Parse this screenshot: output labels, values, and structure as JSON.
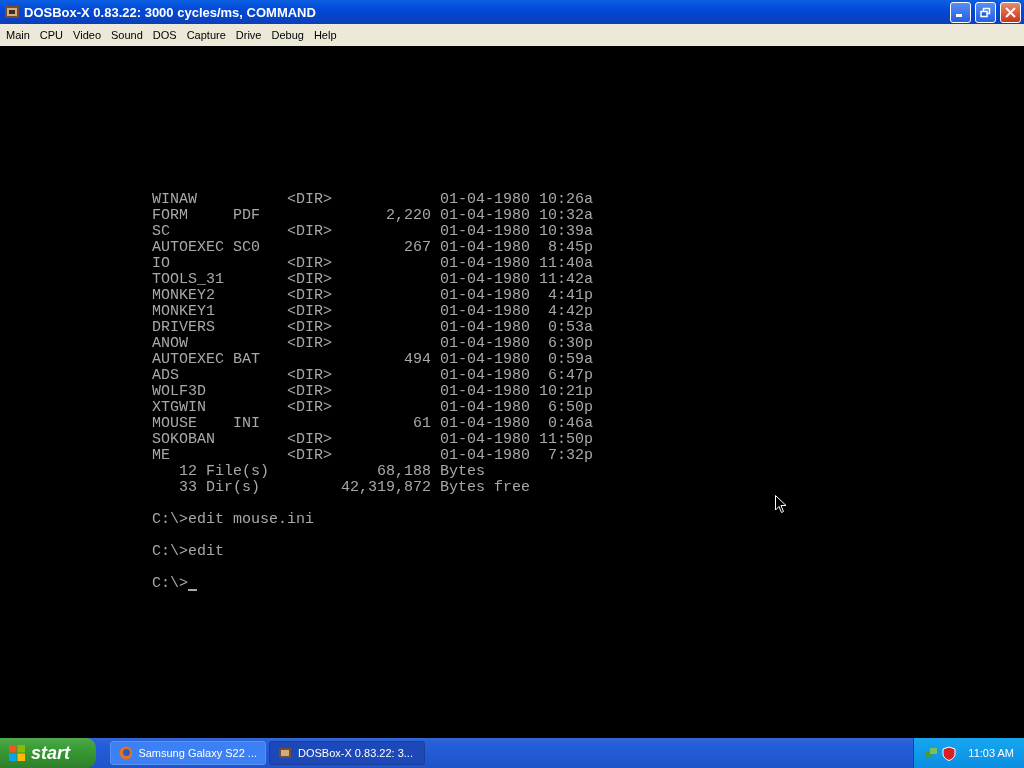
{
  "window": {
    "title": "DOSBox-X 0.83.22: 3000 cycles/ms, COMMAND",
    "buttons": [
      {
        "kind": "minimize"
      },
      {
        "kind": "restore"
      },
      {
        "kind": "close"
      }
    ]
  },
  "menu": [
    "Main",
    "CPU",
    "Video",
    "Sound",
    "DOS",
    "Capture",
    "Drive",
    "Debug",
    "Help"
  ],
  "console": {
    "listing": [
      {
        "name": "WINAW",
        "size": "<DIR>",
        "date": "01-04-1980",
        "time": "10:26a"
      },
      {
        "name": "FORM",
        "ext": "PDF",
        "size": "2,220",
        "date": "01-04-1980",
        "time": "10:32a"
      },
      {
        "name": "SC",
        "size": "<DIR>",
        "date": "01-04-1980",
        "time": "10:39a"
      },
      {
        "name": "AUTOEXEC",
        "ext": "SC0",
        "size": "267",
        "date": "01-04-1980",
        "time": "8:45p"
      },
      {
        "name": "IO",
        "size": "<DIR>",
        "date": "01-04-1980",
        "time": "11:40a"
      },
      {
        "name": "TOOLS_31",
        "size": "<DIR>",
        "date": "01-04-1980",
        "time": "11:42a"
      },
      {
        "name": "MONKEY2",
        "size": "<DIR>",
        "date": "01-04-1980",
        "time": "4:41p"
      },
      {
        "name": "MONKEY1",
        "size": "<DIR>",
        "date": "01-04-1980",
        "time": "4:42p"
      },
      {
        "name": "DRIVERS",
        "size": "<DIR>",
        "date": "01-04-1980",
        "time": "0:53a"
      },
      {
        "name": "ANOW",
        "size": "<DIR>",
        "date": "01-04-1980",
        "time": "6:30p"
      },
      {
        "name": "AUTOEXEC",
        "ext": "BAT",
        "size": "494",
        "date": "01-04-1980",
        "time": "0:59a"
      },
      {
        "name": "ADS",
        "size": "<DIR>",
        "date": "01-04-1980",
        "time": "6:47p"
      },
      {
        "name": "WOLF3D",
        "size": "<DIR>",
        "date": "01-04-1980",
        "time": "10:21p"
      },
      {
        "name": "XTGWIN",
        "size": "<DIR>",
        "date": "01-04-1980",
        "time": "6:50p"
      },
      {
        "name": "MOUSE",
        "ext": "INI",
        "size": "61",
        "date": "01-04-1980",
        "time": "0:46a"
      },
      {
        "name": "SOKOBAN",
        "size": "<DIR>",
        "date": "01-04-1980",
        "time": "11:50p"
      },
      {
        "name": "ME",
        "size": "<DIR>",
        "date": "01-04-1980",
        "time": "7:32p"
      }
    ],
    "summary": [
      {
        "count": "12",
        "label": "File(s)",
        "amount": "68,188",
        "unit": "Bytes"
      },
      {
        "count": "33",
        "label": "Dir(s)",
        "amount": "42,319,872",
        "unit": "Bytes free"
      }
    ],
    "commands": [
      {
        "prompt": "C:\\>",
        "input": "edit mouse.ini"
      },
      {
        "prompt": "C:\\>",
        "input": "edit"
      },
      {
        "prompt": "C:\\>",
        "cursor": true
      }
    ]
  },
  "taskbar": {
    "start": "start",
    "tasks": [
      {
        "kind": "browser",
        "label": "Samsung Galaxy S22 ...",
        "selected": false
      },
      {
        "kind": "dosbox",
        "label": "DOSBox-X 0.83.22: 3...",
        "selected": true
      }
    ],
    "clock": "11:03 AM"
  }
}
